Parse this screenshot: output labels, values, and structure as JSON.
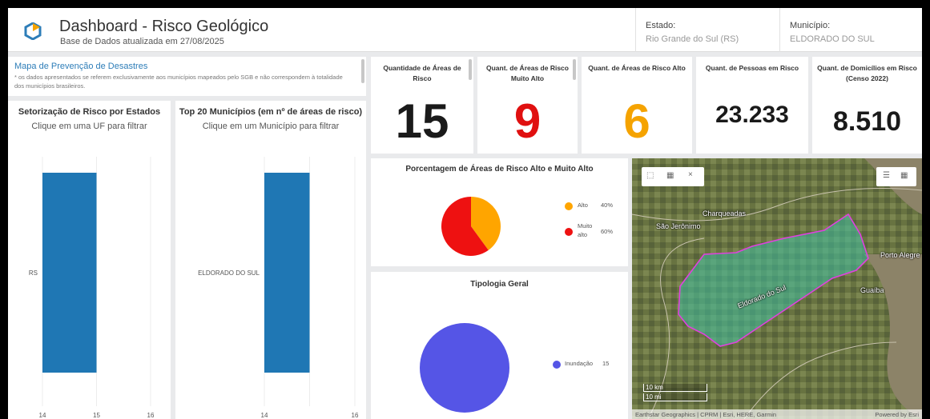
{
  "header": {
    "title": "Dashboard - Risco Geológico",
    "subtitle": "Base de Dados atualizada em 27/08/2025",
    "state_label": "Estado:",
    "state_value": "Rio Grande do Sul (RS)",
    "municipio_label": "Município:",
    "municipio_value": "ELDORADO DO SUL"
  },
  "info": {
    "link": "Mapa de Prevenção de Desastres",
    "note": "* os dados apresentados se referem exclusivamente aos municípios mapeados pelo SGB e não correspondem à totalidade dos municípios brasileiros."
  },
  "chart_data": [
    {
      "type": "bar",
      "orientation": "horizontal",
      "title": "Setorização de Risco por Estados",
      "subtitle": "Clique em uma UF para filtrar",
      "categories": [
        "RS"
      ],
      "values": [
        15
      ],
      "xlim": [
        14,
        16
      ],
      "x_ticks": [
        "14",
        "15",
        "16"
      ],
      "color": "#1f77b4"
    },
    {
      "type": "bar",
      "orientation": "horizontal",
      "title": "Top 20 Municípios (em nº de áreas de risco)",
      "subtitle": "Clique em um Município para filtrar",
      "categories": [
        "ELDORADO DO SUL"
      ],
      "values": [
        15
      ],
      "xlim": [
        14,
        16
      ],
      "x_ticks": [
        "14",
        "16"
      ],
      "color": "#1f77b4"
    },
    {
      "type": "pie",
      "title": "Porcentagem de Áreas de Risco Alto e Muito Alto",
      "slices": [
        {
          "label": "Alto",
          "value": 40,
          "display": "40%",
          "color": "#ffa500"
        },
        {
          "label": "Muito alto",
          "value": 60,
          "display": "60%",
          "color": "#ee1111"
        }
      ]
    },
    {
      "type": "pie",
      "title": "Tipologia Geral",
      "slices": [
        {
          "label": "Inundação",
          "value": 15,
          "display": "15",
          "color": "#5555e6"
        }
      ]
    }
  ],
  "kpis": [
    {
      "label": "Quantidade de Áreas de Risco",
      "value": "15",
      "color": "#1a1a1a"
    },
    {
      "label": "Quant. de Áreas de Risco Muito Alto",
      "value": "9",
      "color": "#e01010"
    },
    {
      "label": "Quant. de Áreas de Risco Alto",
      "value": "6",
      "color": "#f5a300"
    },
    {
      "label": "Quant. de Pessoas em Risco",
      "value": "23.233",
      "color": "#1a1a1a"
    },
    {
      "label": "Quant. de Domicílios em Risco (Censo 2022)",
      "value": "8.510",
      "color": "#1a1a1a"
    }
  ],
  "map": {
    "places": [
      "Charqueadas",
      "São Jerônimo",
      "Porto Alegre",
      "Guaíba",
      "Eldorado do Sul"
    ],
    "scale_km": "10 km",
    "scale_mi": "10 mi",
    "attribution": "Earthstar Geographics | CPRM | Esri, HERE, Garmin",
    "powered": "Powered by Esri",
    "icons": [
      "select-icon",
      "table-icon",
      "close-icon",
      "legend-icon",
      "basemap-icon"
    ]
  }
}
